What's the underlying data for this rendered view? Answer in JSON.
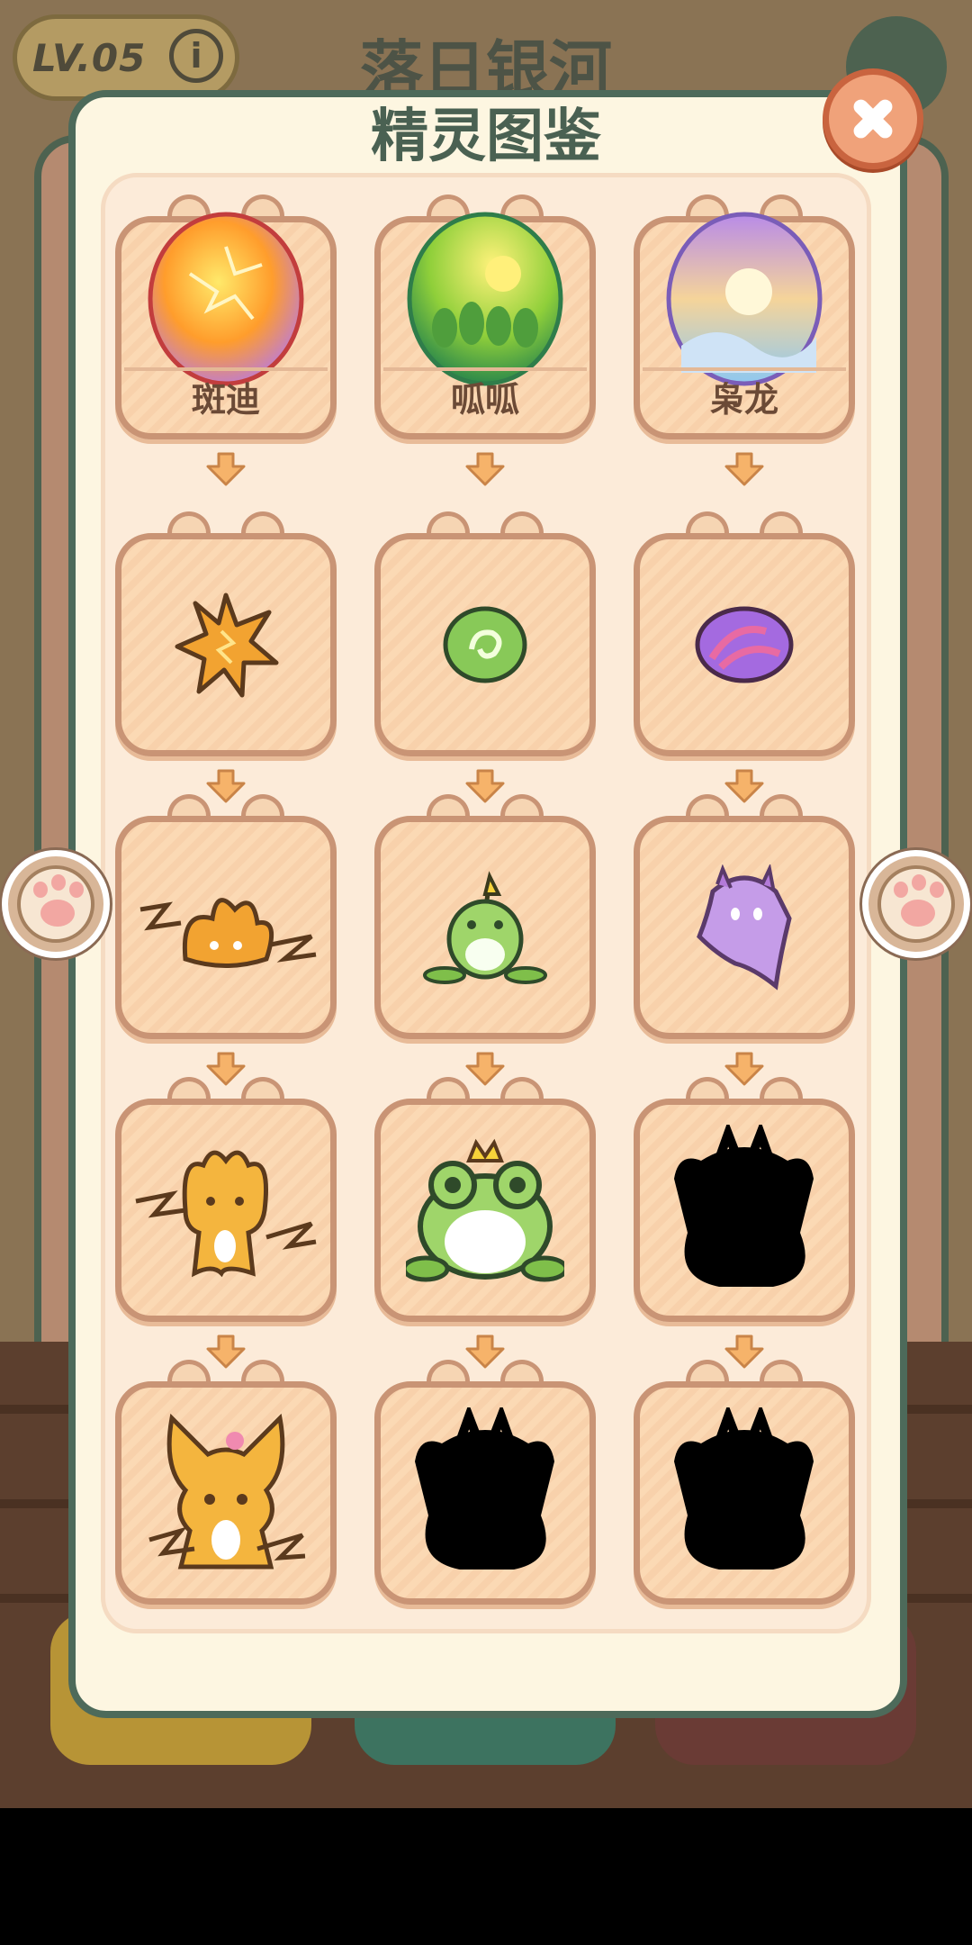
{
  "background": {
    "level_badge": "LV.05",
    "info_icon": "info-icon",
    "title": "落日银河",
    "close_icon": "close-icon"
  },
  "dialog": {
    "title": "精灵图鉴",
    "close_icon": "close-icon",
    "prev_icon": "paw-left-icon",
    "next_icon": "paw-right-icon"
  },
  "columns": [
    {
      "name": "斑迪",
      "stages": [
        "egg-fire-icon",
        "spark-star-icon",
        "flame-cub-icon",
        "lightning-fox-icon",
        "fire-fox-icon"
      ],
      "unlocked": [
        true,
        true,
        true,
        true,
        true
      ]
    },
    {
      "name": "呱呱",
      "stages": [
        "egg-forest-icon",
        "green-seed-icon",
        "sprout-frog-icon",
        "frog-king-icon",
        "locked-silhouette-icon"
      ],
      "unlocked": [
        true,
        true,
        true,
        true,
        false
      ]
    },
    {
      "name": "枭龙",
      "stages": [
        "egg-galaxy-icon",
        "purple-orb-icon",
        "ghost-sprite-icon",
        "locked-silhouette-icon",
        "locked-silhouette-icon"
      ],
      "unlocked": [
        true,
        true,
        true,
        false,
        false
      ]
    }
  ],
  "colors": {
    "panel_border": "#4d6a5a",
    "card_border": "#c99475",
    "title": "#4a6152",
    "close_button": "#f0a27a"
  }
}
